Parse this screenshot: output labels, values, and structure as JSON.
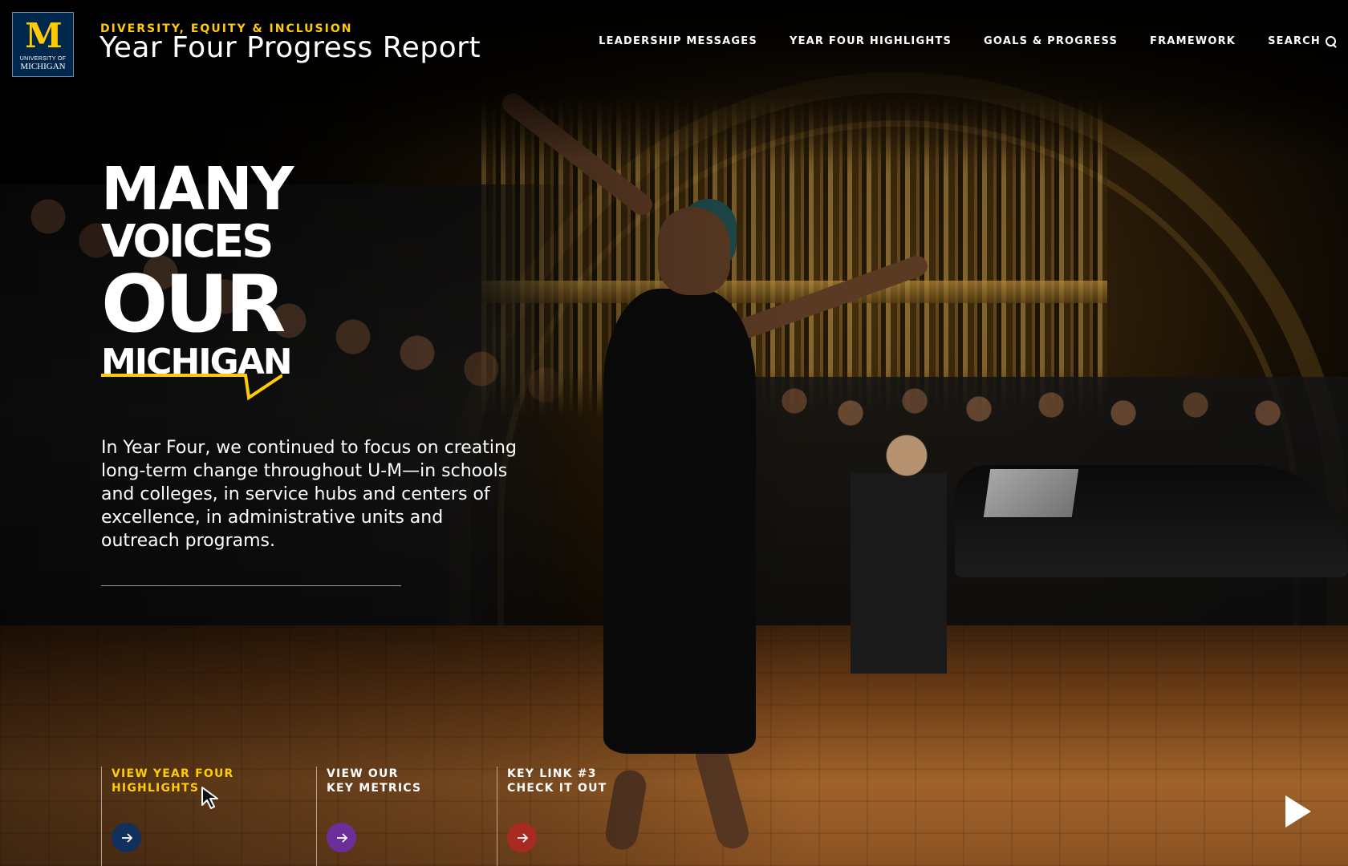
{
  "header": {
    "logo": {
      "mark": "M",
      "line1": "UNIVERSITY OF",
      "line2": "MICHIGAN"
    },
    "eyebrow": "DIVERSITY, EQUITY & INCLUSION",
    "title": "Year Four Progress Report"
  },
  "nav": {
    "items": [
      {
        "label": "LEADERSHIP MESSAGES"
      },
      {
        "label": "YEAR FOUR HIGHLIGHTS"
      },
      {
        "label": "GOALS & PROGRESS"
      },
      {
        "label": "FRAMEWORK"
      }
    ],
    "search_label": "SEARCH",
    "search_icon": "search-icon"
  },
  "hero": {
    "headline": {
      "line1": "MANY",
      "line2": "VOICES",
      "line3": "OUR",
      "line4": "MICHIGAN"
    },
    "intro": "In Year Four, we continued to focus on creating long-term change throughout U-M—in schools and colleges, in service hubs and centers of excellence, in administrative units and outreach programs."
  },
  "key_links": [
    {
      "line1": "VIEW YEAR FOUR",
      "line2": "HIGHLIGHTS",
      "icon": "arrow-right-icon",
      "color": "#12305c",
      "active": true
    },
    {
      "line1": "VIEW OUR",
      "line2": "KEY METRICS",
      "icon": "arrow-right-icon",
      "color": "#6b2e9b",
      "active": false
    },
    {
      "line1": "KEY LINK #3",
      "line2": "CHECK IT OUT",
      "icon": "arrow-right-icon",
      "color": "#a82a22",
      "active": false
    }
  ],
  "colors": {
    "maize": "#ffcb05",
    "blue": "#00274c"
  },
  "media": {
    "play_icon": "play-icon"
  }
}
